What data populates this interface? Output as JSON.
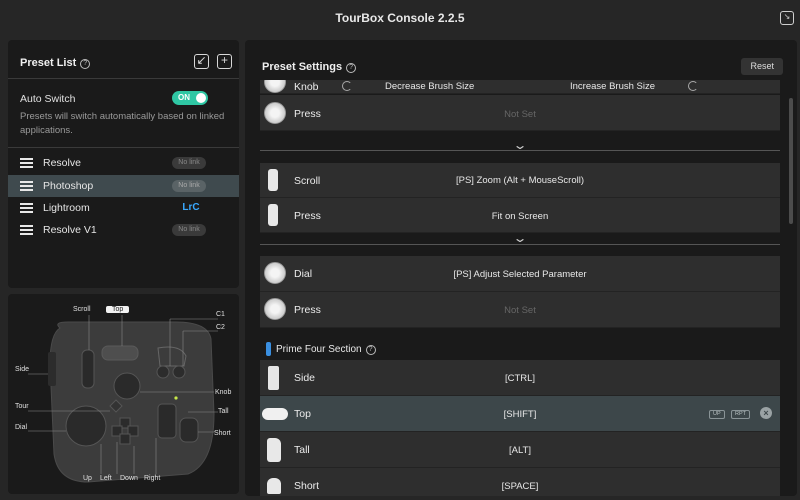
{
  "app": {
    "title": "TourBox Console 2.2.5"
  },
  "preset_list": {
    "header": "Preset List",
    "help": "?",
    "auto_switch": {
      "label": "Auto Switch",
      "state": "ON",
      "description": "Presets will switch automatically based on linked applications."
    },
    "items": [
      {
        "name": "Resolve",
        "badge": "No link"
      },
      {
        "name": "Photoshop",
        "badge": "No link",
        "selected": true
      },
      {
        "name": "Lightroom",
        "badge": "LrC"
      },
      {
        "name": "Resolve V1",
        "badge": "No link"
      }
    ]
  },
  "device": {
    "labels": {
      "scroll": "Scroll",
      "top": "Top",
      "c1": "C1",
      "c2": "C2",
      "side": "Side",
      "knob": "Knob",
      "tour": "Tour",
      "tall": "Tall",
      "dial": "Dial",
      "short": "Short",
      "up": "Up",
      "left": "Left",
      "down": "Down",
      "right": "Right"
    }
  },
  "settings": {
    "header": "Preset Settings",
    "help": "?",
    "reset": "Reset",
    "knob_row": {
      "name": "Knob",
      "left": "Decrease Brush Size",
      "right": "Increase Brush Size"
    },
    "rows": [
      {
        "id": "knob-press",
        "name": "Press",
        "value": "Not Set",
        "muted": true
      },
      {
        "id": "scroll",
        "name": "Scroll",
        "value": "[PS] Zoom (Alt + MouseScroll)"
      },
      {
        "id": "scroll-press",
        "name": "Press",
        "value": "Fit on Screen"
      },
      {
        "id": "dial",
        "name": "Dial",
        "value": "[PS] Adjust Selected Parameter"
      },
      {
        "id": "dial-press",
        "name": "Press",
        "value": "Not Set",
        "muted": true
      }
    ],
    "section": {
      "title": "Prime Four Section",
      "help": "?"
    },
    "prime_rows": [
      {
        "name": "Side",
        "value": "[CTRL]"
      },
      {
        "name": "Top",
        "value": "[SHIFT]",
        "selected": true,
        "badges": [
          "UP",
          "RPT"
        ]
      },
      {
        "name": "Tall",
        "value": "[ALT]"
      },
      {
        "name": "Short",
        "value": "[SPACE]"
      }
    ]
  }
}
